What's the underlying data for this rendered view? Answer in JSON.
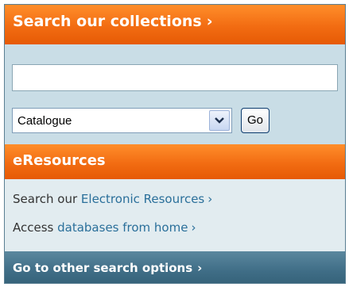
{
  "search_section": {
    "title": "Search our collections",
    "chevron": "›",
    "input_value": "",
    "select_value": "Catalogue",
    "go_label": "Go"
  },
  "eresources_section": {
    "title": "eResources",
    "line1": {
      "prefix": "Search our ",
      "link": "Electronic Resources",
      "chevron": "›"
    },
    "line2": {
      "prefix": "Access ",
      "link": "databases from home",
      "chevron": "›"
    }
  },
  "footer": {
    "label": "Go to other search options",
    "chevron": "›"
  },
  "colors": {
    "orange_header": "#f26c12",
    "search_panel_bg": "#c9dde6",
    "links_panel_bg": "#e2ecf0",
    "footer_bg": "#3f6d86",
    "link_color": "#2a6f9a"
  },
  "icons": {
    "select_arrow": "chevron-down-icon"
  }
}
